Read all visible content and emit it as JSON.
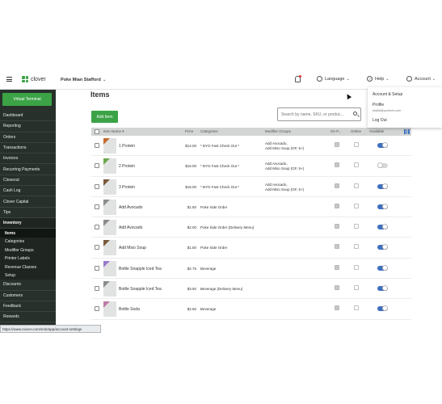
{
  "topbar": {
    "brand": "clover",
    "merchant": "Poke Mian Stafford",
    "language": "Language",
    "help": "Help",
    "account": "Account"
  },
  "sidebar": {
    "virtual_terminal": "Virtual Terminal",
    "items": [
      "Dashboard",
      "Reporting",
      "Orders",
      "Transactions",
      "Invoices",
      "Recurring Payments",
      "Closeout",
      "Cash Log",
      "Clover Capital",
      "Tips"
    ],
    "inventory": "Inventory",
    "inventory_items": [
      "Items",
      "Categories",
      "Modifier Groups",
      "Printer Labels",
      "Revenue Classes",
      "Setup"
    ],
    "active_sub": "Items",
    "after": [
      "Discounts",
      "Customers",
      "Feedback",
      "Rewards"
    ]
  },
  "statusbar": "https://www.clover.com/smb/app/account-settings",
  "main": {
    "title": "Items",
    "add_button": "Add Item",
    "search_placeholder": "Search by name, SKU, or produc...",
    "columns": {
      "name": "Item Name",
      "price": "Price",
      "categories": "Categories",
      "modifier_groups": "Modifier Groups",
      "on_pos": "On P...",
      "online": "Online",
      "available": "Available"
    },
    "rows": [
      {
        "name": "1 Protein",
        "price": "$14.00",
        "category": "* BYO Fast Check Out *",
        "modifiers": [
          "Add Avocado,",
          "Add Miso Soup (GF, 5+)"
        ],
        "on_pos": true,
        "online": false,
        "available": true,
        "thumb": "#c46a2e"
      },
      {
        "name": "2 Protein",
        "price": "$16.00",
        "category": "* BYO Fast Check Out *",
        "modifiers": [
          "Add Avocado,",
          "Add Miso Soup (GF, 5+)"
        ],
        "on_pos": true,
        "online": false,
        "available": false,
        "thumb": "#6aa84f"
      },
      {
        "name": "3 Protein",
        "price": "$18.00",
        "category": "* BYO Fast Check Out *",
        "modifiers": [
          "Add Avocado,",
          "Add Miso Soup (GF, 5+)"
        ],
        "on_pos": true,
        "online": false,
        "available": true,
        "thumb": "#7a5a3c"
      },
      {
        "name": "Add Avocado",
        "price": "$1.50",
        "category": "Poke Side Order",
        "modifiers": [],
        "on_pos": true,
        "online": false,
        "available": true,
        "thumb": "#8c8c8c"
      },
      {
        "name": "Add Avocado",
        "price": "$2.00",
        "category": "Poke Side Order (Delivery Menu)",
        "modifiers": [],
        "on_pos": true,
        "online": false,
        "available": true,
        "thumb": "#8c8c8c"
      },
      {
        "name": "Add Miso Soup",
        "price": "$1.50",
        "category": "Poke Side Order",
        "modifiers": [],
        "on_pos": true,
        "online": false,
        "available": true,
        "thumb": "#7a5a3c"
      },
      {
        "name": "Bottle Snapple Iced Tea",
        "price": "$2.75",
        "category": "Beverage",
        "modifiers": [],
        "on_pos": true,
        "online": false,
        "available": true,
        "thumb": "#9a7ad0"
      },
      {
        "name": "Bottle Snapple Iced Tea",
        "price": "$3.50",
        "category": "Beverage (Delivery Menu)",
        "modifiers": [],
        "on_pos": true,
        "online": false,
        "available": true,
        "thumb": "#8c8c8c"
      },
      {
        "name": "Bottle Soda",
        "price": "$2.50",
        "category": "Beverage",
        "modifiers": [],
        "on_pos": true,
        "online": false,
        "available": true,
        "thumb": "#c07aa8"
      }
    ]
  },
  "account_menu": {
    "account_setup": "Account & Setup",
    "profile": "Profile",
    "email": "khalid@poxtech.com",
    "logout": "Log Out"
  },
  "colors": {
    "brand_green": "#3ba346",
    "sidebar_bg": "#28302c",
    "toggle_on": "#3e6fbf"
  }
}
